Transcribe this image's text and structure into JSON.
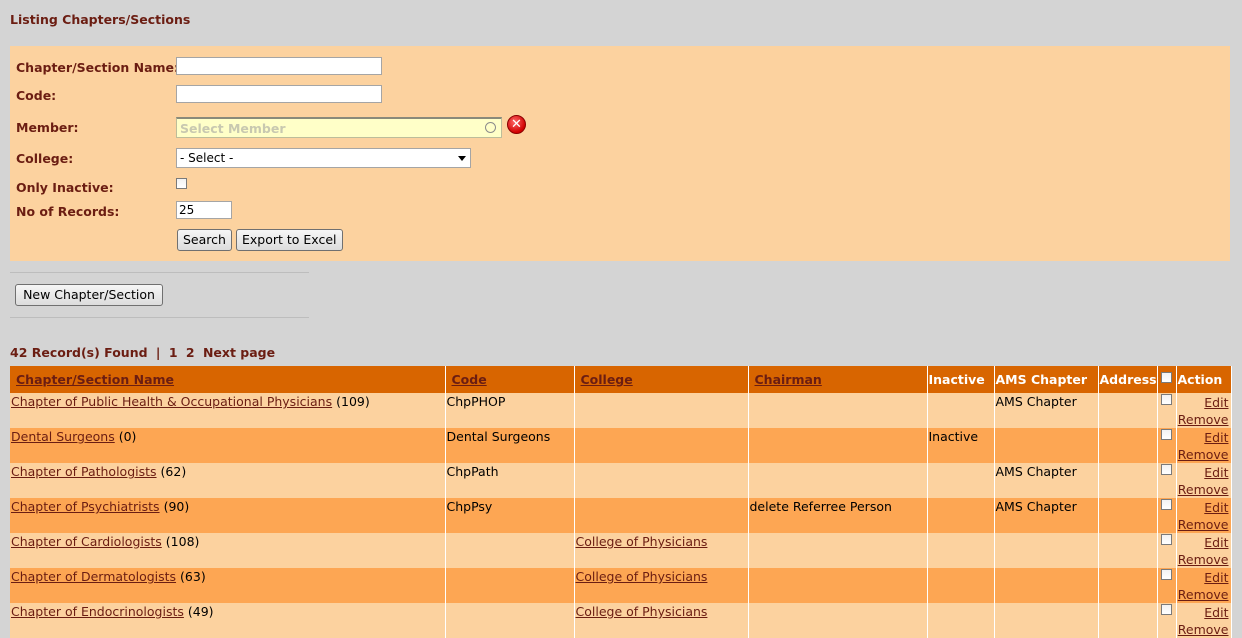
{
  "page": {
    "title": "Listing Chapters/Sections"
  },
  "filters": {
    "name_label": "Chapter/Section Name:",
    "name_value": "",
    "code_label": "Code:",
    "code_value": "",
    "member_label": "Member:",
    "member_placeholder": "Select Member",
    "college_label": "College:",
    "college_selected": "- Select -",
    "inactive_label": "Only Inactive:",
    "records_label": "No of Records:",
    "records_value": "25",
    "search_label": "Search",
    "export_label": "Export to Excel"
  },
  "new_button_label": "New Chapter/Section",
  "pager": {
    "records_found": "42 Record(s) Found",
    "separator": "|",
    "page1": "1",
    "page2": "2",
    "next": "Next page"
  },
  "table": {
    "headers": {
      "name": "Chapter/Section Name",
      "code": "Code",
      "college": "College",
      "chairman": "Chairman",
      "inactive": "Inactive",
      "ams": "AMS Chapter",
      "address": "Address",
      "action": "Action"
    },
    "edit_label": "Edit",
    "remove_label": "Remove",
    "rows": [
      {
        "name": "Chapter of Public Health & Occupational Physicians",
        "count": "(109)",
        "code": "ChpPHOP",
        "college": "",
        "chairman": "",
        "inactive": "",
        "ams": "AMS Chapter",
        "address": ""
      },
      {
        "name": "Dental Surgeons",
        "count": "(0)",
        "code": "Dental Surgeons",
        "college": "",
        "chairman": "",
        "inactive": "Inactive",
        "ams": "",
        "address": ""
      },
      {
        "name": "Chapter of Pathologists",
        "count": "(62)",
        "code": "ChpPath",
        "college": "",
        "chairman": "",
        "inactive": "",
        "ams": "AMS Chapter",
        "address": ""
      },
      {
        "name": "Chapter of Psychiatrists",
        "count": "(90)",
        "code": "ChpPsy",
        "college": "",
        "chairman": "delete Referree Person",
        "inactive": "",
        "ams": "AMS Chapter",
        "address": ""
      },
      {
        "name": "Chapter of Cardiologists",
        "count": "(108)",
        "code": "",
        "college": "College of Physicians",
        "chairman": "",
        "inactive": "",
        "ams": "",
        "address": ""
      },
      {
        "name": "Chapter of Dermatologists",
        "count": "(63)",
        "code": "",
        "college": "College of Physicians",
        "chairman": "",
        "inactive": "",
        "ams": "",
        "address": ""
      },
      {
        "name": "Chapter of Endocrinologists",
        "count": "(49)",
        "code": "",
        "college": "College of Physicians",
        "chairman": "",
        "inactive": "",
        "ams": "",
        "address": ""
      }
    ]
  }
}
